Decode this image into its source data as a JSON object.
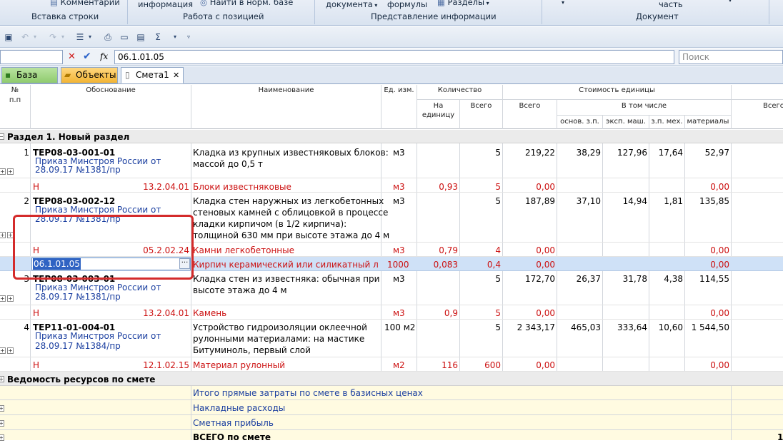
{
  "ribbon": {
    "comments": "Комментарии",
    "info": "информация",
    "find_norm": "Найти в норм. базе",
    "document": "документа",
    "formulas": "формулы",
    "sections": "Разделы",
    "part": "часть",
    "group_insert_row": "Вставка строки",
    "group_position": "Работа с позицией",
    "group_view": "Представление информации",
    "group_document": "Документ"
  },
  "formula": {
    "value": "06.1.01.05",
    "cancel_icon": "✕",
    "accept_icon": "✔",
    "fx": "fx",
    "search_placeholder": "Поиск"
  },
  "tabs": [
    {
      "label": "База"
    },
    {
      "label": "Объекты"
    },
    {
      "label": "Смета1"
    }
  ],
  "tab_close": "✕",
  "columns": {
    "num": "№",
    "num2": "п.п",
    "basis": "Обоснование",
    "name": "Наименование",
    "unit": "Ед. изм.",
    "qty": "Количество",
    "per_unit": "На",
    "per_unit2": "единицу",
    "qty_total": "Всего",
    "unit_cost": "Стоимость единицы",
    "total": "Всего",
    "incl": "В том числе",
    "salary": "основ. з.п.",
    "machines": "эксп. маш.",
    "mech_salary": "з.п. мех.",
    "materials": "материалы",
    "grand_total": "Всего"
  },
  "section_title": "Раздел 1. Новый раздел",
  "positions": [
    {
      "num": "1",
      "code": "ТЕР08-03-001-01",
      "order1": "Приказ Минстроя России от",
      "order2": "28.09.17 №1381/пр",
      "name": [
        "Кладка из крупных известняковых блоков:",
        "массой до 0,5 т"
      ],
      "unit": "м3",
      "qty_total": "5",
      "total": "219,22",
      "salary": "38,29",
      "machines": "127,96",
      "mech_salary": "17,64",
      "materials": "52,97"
    },
    {
      "num": "2",
      "code": "ТЕР08-03-002-12",
      "order1": "Приказ Минстроя России от",
      "order2": "28.09.17 №1381/пр",
      "name": [
        "Кладка стен наружных из легкобетонных",
        "стеновых камней с облицовкой в процессе",
        "кладки кирпичом (в 1/2 кирпича):",
        "толщиной 630 мм при высоте этажа до 4 м"
      ],
      "unit": "м3",
      "qty_total": "5",
      "total": "187,89",
      "salary": "37,10",
      "machines": "14,94",
      "mech_salary": "1,81",
      "materials": "135,85"
    },
    {
      "num": "3",
      "code": "ТЕР08-03-003-01",
      "order1": "Приказ Минстроя России от",
      "order2": "28.09.17 №1381/пр",
      "name": [
        "Кладка стен из известняка: обычная при",
        "высоте этажа до 4 м"
      ],
      "unit": "м3",
      "qty_total": "5",
      "total": "172,70",
      "salary": "26,37",
      "machines": "31,78",
      "mech_salary": "4,38",
      "materials": "114,55"
    },
    {
      "num": "4",
      "code": "ТЕР11-01-004-01",
      "order1": "Приказ Минстроя России от",
      "order2": "28.09.17 №1384/пр",
      "name": [
        "Устройство гидроизоляции оклеечной",
        "рулонными материалами: на мастике",
        "Битуминоль, первый слой"
      ],
      "unit": "100 м2",
      "qty_total": "5",
      "total": "2 343,17",
      "salary": "465,03",
      "machines": "333,64",
      "mech_salary": "10,60",
      "materials": "1 544,50"
    }
  ],
  "resources": [
    {
      "flag": "Н",
      "code": "13.2.04.01",
      "name": "Блоки известняковые",
      "unit": "м3",
      "per_unit": "0,93",
      "qty_total": "5",
      "total": "0,00",
      "materials": "0,00"
    },
    {
      "flag": "Н",
      "code": "05.2.02.24",
      "name": "Камни легкобетонные",
      "unit": "м3",
      "per_unit": "0,79",
      "qty_total": "4",
      "total": "0,00",
      "materials": "0,00"
    },
    {
      "flag": "",
      "code": "06.1.01.05",
      "name": "Кирпич керамический или силикатный ли...",
      "unit": "1000",
      "per_unit": "0,083",
      "qty_total": "0,4",
      "total": "0,00",
      "materials": "0,00"
    },
    {
      "flag": "Н",
      "code": "13.2.04.01",
      "name": "Камень",
      "unit": "м3",
      "per_unit": "0,9",
      "qty_total": "5",
      "total": "0,00",
      "materials": "0,00"
    },
    {
      "flag": "Н",
      "code": "12.1.02.15",
      "name": "Материал рулонный",
      "unit": "м2",
      "per_unit": "116",
      "qty_total": "600",
      "total": "0,00",
      "materials": "0,00"
    }
  ],
  "summary": {
    "title": "Ведомость ресурсов по смете",
    "rows": [
      "Итого прямые затраты по смете в базисных ценах",
      "Накладные расходы",
      "Сметная прибыль",
      "ВСЕГО по смете"
    ],
    "last_total": "1"
  },
  "ellipsis": "···",
  "colors": {
    "selection": "#cfe1f7",
    "red_marker": "#d42b2b",
    "section_bg": "#ebebeb",
    "footer_bg": "#fffbe1"
  }
}
